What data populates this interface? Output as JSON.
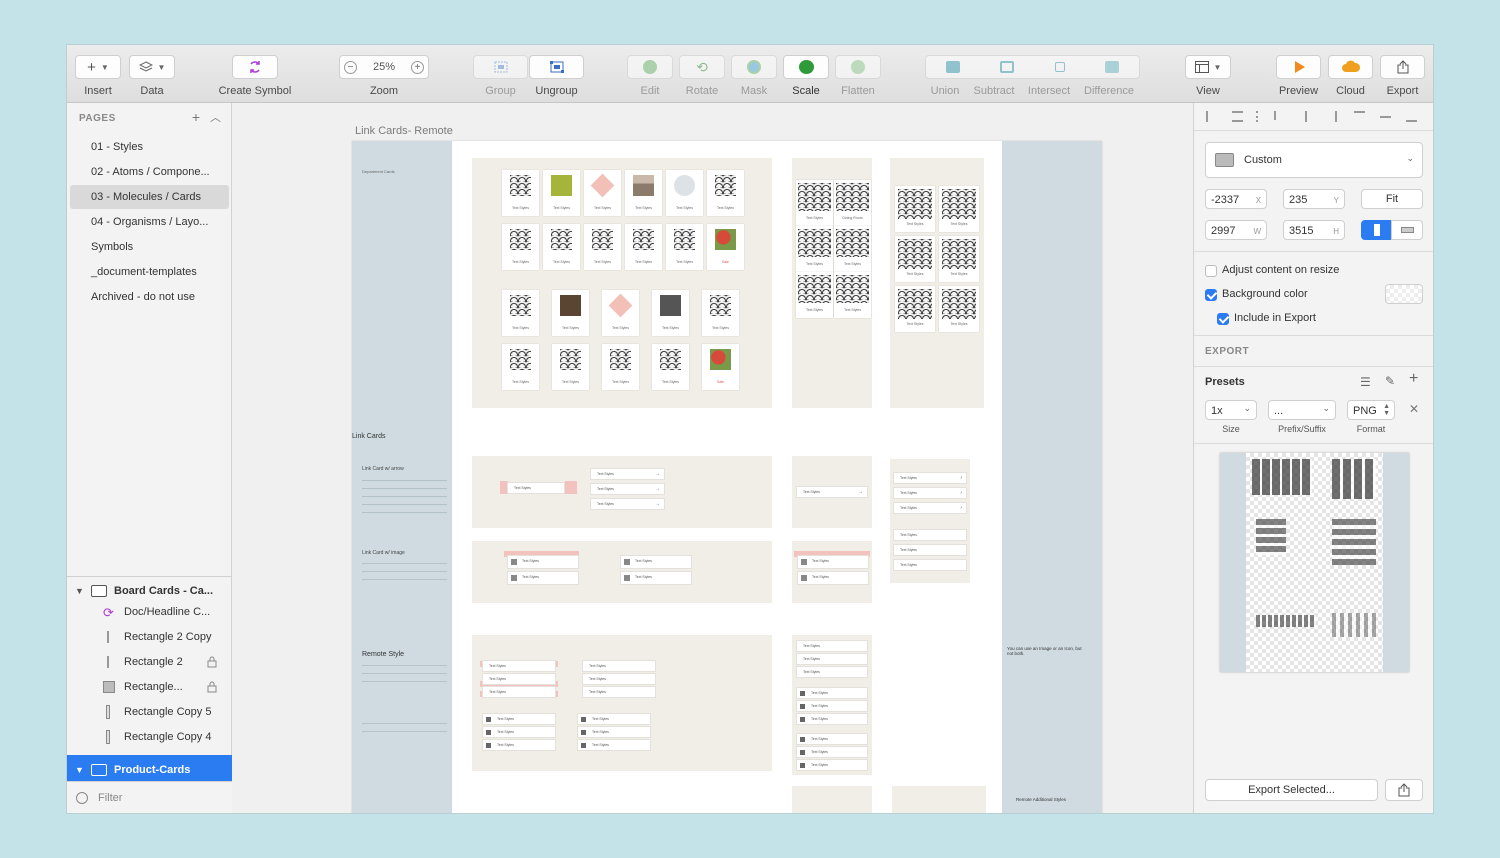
{
  "toolbar": {
    "insert": "Insert",
    "data": "Data",
    "create_symbol": "Create Symbol",
    "zoom_value": "25%",
    "zoom": "Zoom",
    "group": "Group",
    "ungroup": "Ungroup",
    "edit": "Edit",
    "rotate": "Rotate",
    "mask": "Mask",
    "scale": "Scale",
    "flatten": "Flatten",
    "union": "Union",
    "subtract": "Subtract",
    "intersect": "Intersect",
    "difference": "Difference",
    "view": "View",
    "preview": "Preview",
    "cloud": "Cloud",
    "export": "Export"
  },
  "sidebar": {
    "pages_heading": "PAGES",
    "pages": [
      "01 - Styles",
      "02 - Atoms / Compone...",
      "03 - Molecules / Cards",
      "04 - Organisms / Layo...",
      "Symbols",
      "_document-templates",
      "Archived - do not use"
    ],
    "layers": [
      "Board Cards - Ca...",
      "Doc/Headline C...",
      "Rectangle 2 Copy",
      "Rectangle 2",
      "Rectangle...",
      "Rectangle Copy 5",
      "Rectangle Copy 4",
      "Product-Cards"
    ],
    "filter_placeholder": "Filter"
  },
  "canvas": {
    "artboard_title": "Link Cards- Remote",
    "department_cards": "Department Cards",
    "link_cards": "Link Cards",
    "link_card_arrow": "Link Card w/ arrow",
    "link_card_image": "Link Card w/ image",
    "remote_style": "Remote Style",
    "text_styles": "Text Styles",
    "dining_room": "Dining Room",
    "sale": "Sale",
    "right_note": "You can use an Image or an Icon, but not both.",
    "remote_additional": "Remote Additional Styles"
  },
  "inspector": {
    "preset": "Custom",
    "x": "-2337",
    "x_label": "X",
    "y": "235",
    "y_label": "Y",
    "fit": "Fit",
    "w": "2997",
    "w_label": "W",
    "h": "3515",
    "h_label": "H",
    "adjust_content": "Adjust content on resize",
    "background_color": "Background color",
    "include_in_export": "Include in Export",
    "export_heading": "EXPORT",
    "presets": "Presets",
    "size_value": "1x",
    "prefix_value": "...",
    "format_value": "PNG",
    "size_label": "Size",
    "prefix_label": "Prefix/Suffix",
    "format_label": "Format",
    "export_selected": "Export Selected..."
  },
  "colors": {
    "accent": "#2b7cf0",
    "background": "#c3e3e8",
    "artboard_side": "#cfdbe1",
    "section_bg": "#f1ede7"
  }
}
